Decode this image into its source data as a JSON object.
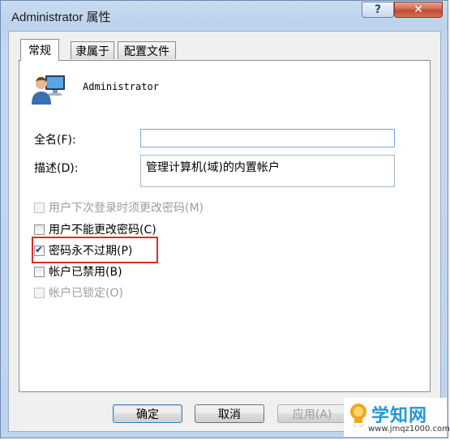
{
  "window": {
    "title": "Administrator 属性",
    "help_label": "?",
    "close_label": "✕"
  },
  "tabs": [
    {
      "label": "常规",
      "active": true
    },
    {
      "label": "隶属于",
      "active": false
    },
    {
      "label": "配置文件",
      "active": false
    }
  ],
  "user": {
    "name": "Administrator",
    "icon": "user-icon"
  },
  "fields": {
    "fullname_label": "全名(F):",
    "fullname_value": "",
    "description_label": "描述(D):",
    "description_value": "管理计算机(域)的内置帐户"
  },
  "checkboxes": [
    {
      "label": "用户下次登录时须更改密码(M)",
      "checked": false,
      "enabled": false
    },
    {
      "label": "用户不能更改密码(C)",
      "checked": false,
      "enabled": true
    },
    {
      "label": "密码永不过期(P)",
      "checked": true,
      "enabled": true
    },
    {
      "label": "帐户已禁用(B)",
      "checked": false,
      "enabled": true
    },
    {
      "label": "帐户已锁定(O)",
      "checked": false,
      "enabled": false
    }
  ],
  "buttons": {
    "ok": "确定",
    "cancel": "取消",
    "apply": "应用(A)"
  },
  "watermark": {
    "title": "学知网",
    "url": "www.jmqz1000.com"
  },
  "colors": {
    "highlight": "#d92b2b",
    "watermark_blue": "#2596d6"
  }
}
